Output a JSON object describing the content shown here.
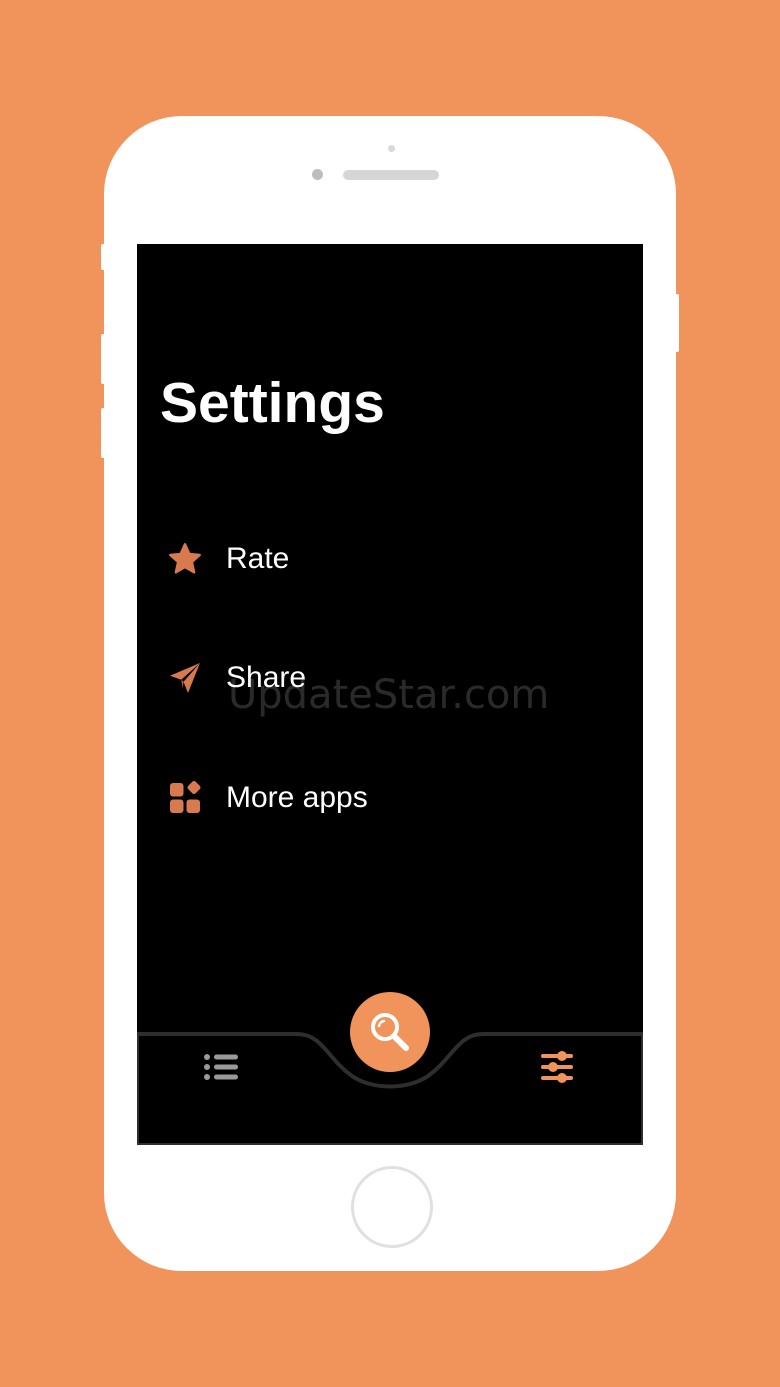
{
  "screen": {
    "title": "Settings",
    "menu": [
      {
        "label": "Rate",
        "icon": "star-icon"
      },
      {
        "label": "Share",
        "icon": "paper-plane-icon"
      },
      {
        "label": "More apps",
        "icon": "apps-grid-icon"
      }
    ]
  },
  "watermark": "UpdateStar.com",
  "tabbar": {
    "left_tab_icon": "list-icon",
    "center_button_icon": "search-icon",
    "right_tab_icon": "sliders-icon"
  },
  "colors": {
    "background": "#F0945C",
    "accent": "#F0945C",
    "icon_accent": "#D77B4E",
    "screen": "#000000",
    "text": "#FFFFFF",
    "inactive_tab": "#9A9A9A"
  }
}
